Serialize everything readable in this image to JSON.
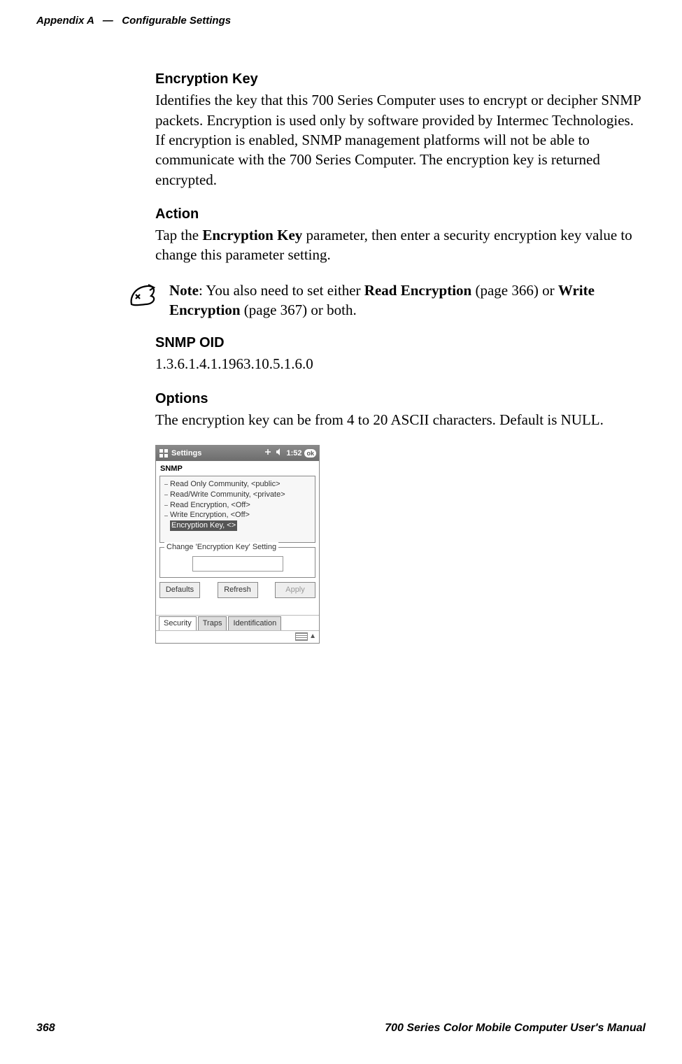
{
  "page": {
    "appendix_label": "Appendix A",
    "header_separator": "—",
    "header_section": "Configurable Settings",
    "page_number": "368",
    "manual_title": "700 Series Color Mobile Computer User's Manual"
  },
  "sections": {
    "encryption_key": {
      "heading": "Encryption Key",
      "body": "Identifies the key that this 700 Series Computer uses to encrypt or decipher SNMP packets. Encryption is used only by software provided by Intermec Technologies. If encryption is enabled, SNMP management platforms will not be able to communicate with the 700 Series Computer. The encryption key is returned encrypted."
    },
    "action": {
      "heading": "Action",
      "body_pre": "Tap the ",
      "body_bold": "Encryption Key",
      "body_post": " parameter, then enter a security encryption key value to change this parameter setting."
    },
    "note": {
      "label": "Note",
      "text_pre": ": You also need to set either ",
      "read_enc": "Read Encryption",
      "read_page": " (page 366) or ",
      "write_enc": "Write Encryption",
      "write_page": " (page 367) or both."
    },
    "snmp_oid": {
      "heading": "SNMP OID",
      "value": "1.3.6.1.4.1.1963.10.5.1.6.0"
    },
    "options": {
      "heading": "Options",
      "body": "The encryption key can be from 4 to 20 ASCII characters. Default is NULL."
    }
  },
  "screenshot": {
    "titlebar_label": "Settings",
    "titlebar_time": "1:52",
    "ok": "ok",
    "app_title": "SNMP",
    "tree": {
      "item1": "Read Only Community, <public>",
      "item2": "Read/Write Community, <private>",
      "item3": "Read Encryption, <Off>",
      "item4": "Write Encryption, <Off>",
      "item5": "Encryption Key, <>"
    },
    "fieldset_legend": "Change 'Encryption Key' Setting",
    "buttons": {
      "defaults": "Defaults",
      "refresh": "Refresh",
      "apply": "Apply"
    },
    "tabs": {
      "security": "Security",
      "traps": "Traps",
      "identification": "Identification"
    }
  }
}
